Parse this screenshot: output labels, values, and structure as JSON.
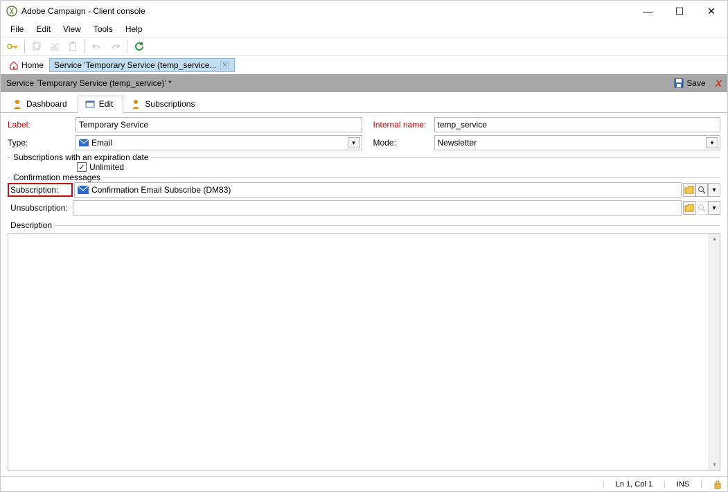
{
  "window": {
    "title": "Adobe Campaign - Client console",
    "min": "—",
    "max": "☐",
    "close": "✕"
  },
  "menu": [
    "File",
    "Edit",
    "View",
    "Tools",
    "Help"
  ],
  "nav": {
    "home": "Home",
    "tab_label": "Service 'Temporary Service (temp_service..."
  },
  "header": {
    "title": "Service 'Temporary Service (temp_service)' *",
    "save": "Save"
  },
  "tabs": {
    "dashboard": "Dashboard",
    "edit": "Edit",
    "subscriptions": "Subscriptions"
  },
  "form": {
    "label_lbl": "Label:",
    "label_value": "Temporary Service",
    "internal_lbl": "Internal name:",
    "internal_value": "temp_service",
    "type_lbl": "Type:",
    "type_value": "Email",
    "mode_lbl": "Mode:",
    "mode_value": "Newsletter",
    "expiration_legend": "Subscriptions with an expiration date",
    "unlimited": "Unlimited",
    "confirm_legend": "Confirmation messages",
    "sub_lbl": "Subscription:",
    "sub_value": "Confirmation Email Subscribe (DM83)",
    "unsub_lbl": "Unsubscription:",
    "unsub_value": "",
    "desc_lbl": "Description"
  },
  "status": {
    "pos": "Ln 1, Col 1",
    "ins": "INS"
  }
}
